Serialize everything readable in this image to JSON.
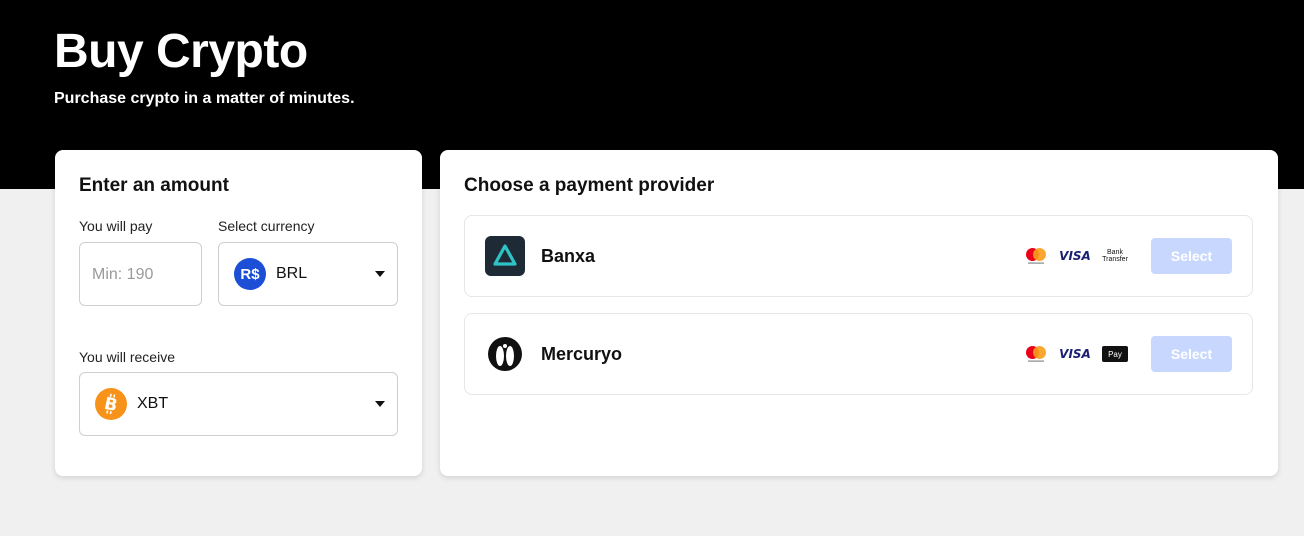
{
  "header": {
    "title": "Buy Crypto",
    "subtitle": "Purchase crypto in a matter of minutes."
  },
  "amount_card": {
    "title": "Enter an amount",
    "pay_label": "You will pay",
    "pay_placeholder": "Min: 190",
    "currency_label": "Select currency",
    "currency_symbol": "R$",
    "currency_value": "BRL",
    "receive_label": "You will receive",
    "receive_value": "XBT"
  },
  "provider_card": {
    "title": "Choose a payment provider",
    "providers": [
      {
        "name": "Banxa",
        "methods": [
          "mastercard",
          "VISA",
          "Bank Transfer"
        ],
        "select_label": "Select"
      },
      {
        "name": "Mercuryo",
        "methods": [
          "mastercard",
          "VISA",
          "Pay"
        ],
        "select_label": "Select"
      }
    ]
  },
  "colors": {
    "header_bg": "#000000",
    "select_button_bg": "#c8d7fd",
    "brl_coin": "#1c4fd6",
    "btc_coin": "#f7931a",
    "banxa_logo_bg": "#1e2a36",
    "banxa_logo_accent": "#2ec4c6"
  },
  "icons": [
    "brl-coin-icon",
    "btc-icon",
    "caret-down-icon",
    "banxa-logo",
    "mercuryo-logo",
    "mastercard-icon",
    "visa-icon",
    "bank-transfer-icon",
    "apple-pay-icon"
  ]
}
